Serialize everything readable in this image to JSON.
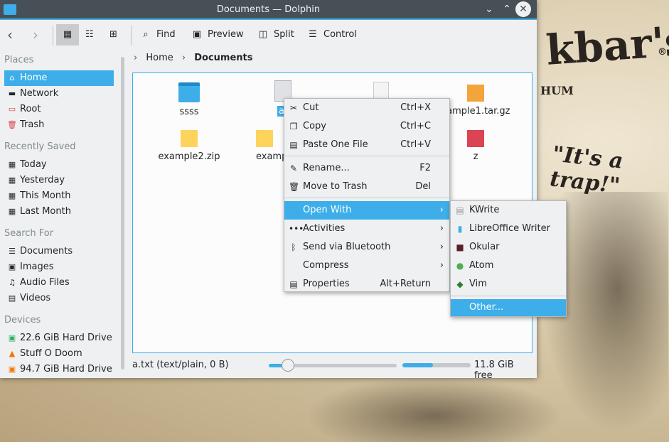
{
  "window": {
    "title": "Documents — Dolphin"
  },
  "toolbar": {
    "find": "Find",
    "preview": "Preview",
    "split": "Split",
    "control": "Control"
  },
  "sidebar": {
    "places_header": "Places",
    "places": [
      {
        "label": "Home",
        "icon": "home-icon"
      },
      {
        "label": "Network",
        "icon": "network-icon"
      },
      {
        "label": "Root",
        "icon": "root-folder-icon"
      },
      {
        "label": "Trash",
        "icon": "trash-icon"
      }
    ],
    "recent_header": "Recently Saved",
    "recent": [
      {
        "label": "Today"
      },
      {
        "label": "Yesterday"
      },
      {
        "label": "This Month"
      },
      {
        "label": "Last Month"
      }
    ],
    "search_header": "Search For",
    "search": [
      {
        "label": "Documents"
      },
      {
        "label": "Images"
      },
      {
        "label": "Audio Files"
      },
      {
        "label": "Videos"
      }
    ],
    "devices_header": "Devices",
    "devices": [
      {
        "label": "22.6 GiB Hard Drive"
      },
      {
        "label": "Stuff O Doom"
      },
      {
        "label": "94.7 GiB Hard Drive"
      }
    ]
  },
  "breadcrumb": {
    "home": "Home",
    "current": "Documents"
  },
  "files": [
    {
      "name": "ssss",
      "type": "folder"
    },
    {
      "name": "a.",
      "type": "text",
      "selected": true
    },
    {
      "name": "",
      "type": "text"
    },
    {
      "name": "xample1.tar.gz",
      "type": "archive-orange"
    },
    {
      "name": "example2.zip",
      "type": "archive-yellow"
    },
    {
      "name": "examp",
      "type": "archive-yellow"
    },
    {
      "name": "z",
      "type": "archive-red"
    }
  ],
  "status": {
    "selection": "a.txt (text/plain, 0 B)",
    "zoom_level": 0.15,
    "disk_used_fraction": 0.45,
    "free": "11.8 GiB free"
  },
  "context_menu": [
    {
      "label": "Cut",
      "shortcut": "Ctrl+X",
      "icon": "scissors-icon"
    },
    {
      "label": "Copy",
      "shortcut": "Ctrl+C",
      "icon": "copy-icon"
    },
    {
      "label": "Paste One File",
      "shortcut": "Ctrl+V",
      "icon": "paste-icon"
    },
    {
      "label": "Rename...",
      "shortcut": "F2",
      "icon": "pencil-icon"
    },
    {
      "label": "Move to Trash",
      "shortcut": "Del",
      "icon": "trash-icon"
    },
    {
      "label": "Open With",
      "submenu": true
    },
    {
      "label": "Activities",
      "submenu": true,
      "icon": "activities-icon"
    },
    {
      "label": "Send via Bluetooth",
      "submenu": true,
      "icon": "bluetooth-icon"
    },
    {
      "label": "Compress",
      "submenu": true
    },
    {
      "label": "Properties",
      "shortcut": "Alt+Return",
      "icon": "properties-icon"
    }
  ],
  "open_with": [
    {
      "label": "KWrite"
    },
    {
      "label": "LibreOffice Writer"
    },
    {
      "label": "Okular"
    },
    {
      "label": "Atom"
    },
    {
      "label": "Vim"
    },
    {
      "label": "Other..."
    }
  ],
  "wallpaper": {
    "text1": "kbar's",
    "text2": "HUM",
    "text3": "\"It's a trap!\"",
    "mark": "®"
  },
  "colors": {
    "accent": "#3daee9",
    "titlebar": "#475057"
  }
}
